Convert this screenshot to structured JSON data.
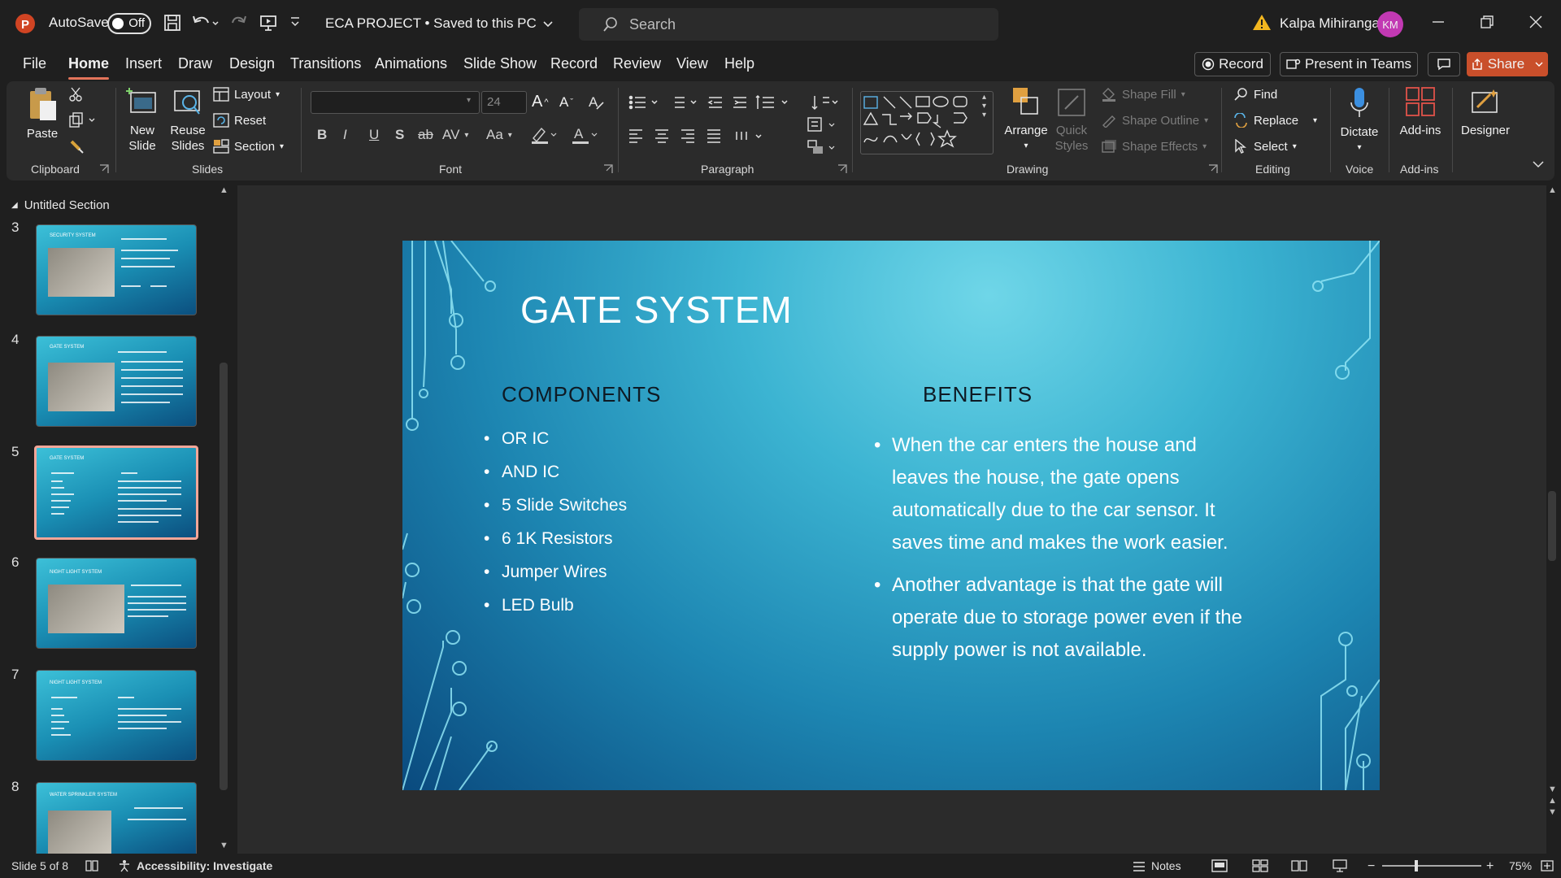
{
  "titlebar": {
    "autosave_label": "AutoSave",
    "autosave_state": "Off",
    "document_title": "ECA PROJECT • Saved to this PC",
    "search_placeholder": "Search",
    "user_name": "Kalpa Mihiranga",
    "user_initials": "KM"
  },
  "menu": {
    "items": [
      "File",
      "Home",
      "Insert",
      "Draw",
      "Design",
      "Transitions",
      "Animations",
      "Slide Show",
      "Record",
      "Review",
      "View",
      "Help"
    ],
    "active": "Home",
    "record_label": "Record",
    "present_label": "Present in Teams",
    "share_label": "Share"
  },
  "ribbon": {
    "clipboard": {
      "label": "Clipboard",
      "paste": "Paste"
    },
    "slides": {
      "label": "Slides",
      "new_slide_1": "New",
      "new_slide_2": "Slide",
      "reuse_1": "Reuse",
      "reuse_2": "Slides",
      "layout": "Layout",
      "reset": "Reset",
      "section": "Section"
    },
    "font": {
      "label": "Font",
      "font_name": "",
      "font_size": "24",
      "bold": "B",
      "italic": "I",
      "underline": "U",
      "shadow": "S",
      "strike": "ab",
      "spacing": "AV",
      "case": "Aa"
    },
    "paragraph": {
      "label": "Paragraph"
    },
    "drawing": {
      "label": "Drawing",
      "arrange": "Arrange",
      "quick_1": "Quick",
      "quick_2": "Styles",
      "shape_fill": "Shape Fill",
      "shape_outline": "Shape Outline",
      "shape_effects": "Shape Effects"
    },
    "editing": {
      "label": "Editing",
      "find": "Find",
      "replace": "Replace",
      "select": "Select"
    },
    "voice": {
      "label": "Voice",
      "dictate": "Dictate"
    },
    "addins": {
      "label": "Add-ins",
      "addins_btn": "Add-ins"
    },
    "designer": "Designer"
  },
  "thumbnails": {
    "section": "Untitled Section",
    "slides": [
      {
        "num": "3",
        "title": "SECURITY SYSTEM"
      },
      {
        "num": "4",
        "title": "GATE SYSTEM"
      },
      {
        "num": "5",
        "title": "GATE SYSTEM"
      },
      {
        "num": "6",
        "title": "NIGHT LIGHT SYSTEM"
      },
      {
        "num": "7",
        "title": "NIGHT LIGHT SYSTEM"
      },
      {
        "num": "8",
        "title": "WATER SPRINKLER SYSTEM"
      }
    ]
  },
  "slide": {
    "title": "GATE SYSTEM",
    "components_heading": "COMPONENTS",
    "benefits_heading": "BENEFITS",
    "components": [
      "OR IC",
      "AND IC",
      "5 Slide Switches",
      "6 1K Resistors",
      "Jumper Wires",
      "LED Bulb"
    ],
    "benefits": [
      "When the car enters the house and leaves the house, the gate opens automatically due to the car sensor. It saves time and makes the work easier.",
      "Another advantage is that the gate will operate due to storage power even if the supply power is not available."
    ]
  },
  "status": {
    "slide_info": "Slide 5 of 8",
    "accessibility": "Accessibility: Investigate",
    "notes": "Notes",
    "zoom": "75%"
  },
  "colors": {
    "accent": "#e3745a",
    "share_bg": "#c94f2b",
    "avatar_bg": "#c239b3"
  }
}
